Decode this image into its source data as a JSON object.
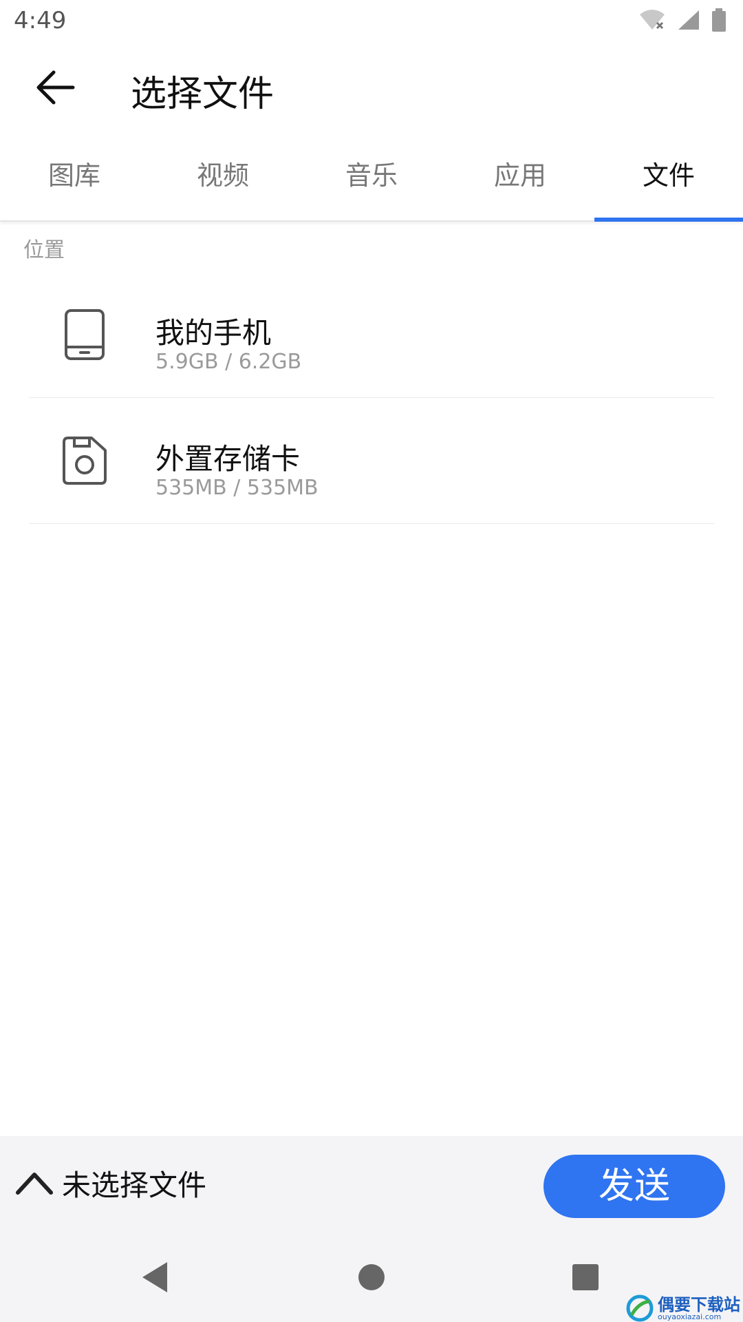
{
  "status_bar": {
    "time": "4:49"
  },
  "app_bar": {
    "title": "选择文件"
  },
  "tabs": [
    {
      "label": "图库"
    },
    {
      "label": "视频"
    },
    {
      "label": "音乐"
    },
    {
      "label": "应用"
    },
    {
      "label": "文件"
    }
  ],
  "active_tab": "文件",
  "section": {
    "label": "位置"
  },
  "locations": [
    {
      "title": "我的手机",
      "usage": "5.9GB / 6.2GB",
      "icon": "phone-icon"
    },
    {
      "title": "外置存储卡",
      "usage": "535MB / 535MB",
      "icon": "sd-card-icon"
    }
  ],
  "bottom": {
    "selection_text": "未选择文件",
    "send_label": "发送"
  },
  "watermark": {
    "main": "偶要下载站",
    "sub": "ouyaoxiazai.com"
  },
  "colors": {
    "accent": "#2f74f0",
    "panel": "#f4f4f6"
  }
}
